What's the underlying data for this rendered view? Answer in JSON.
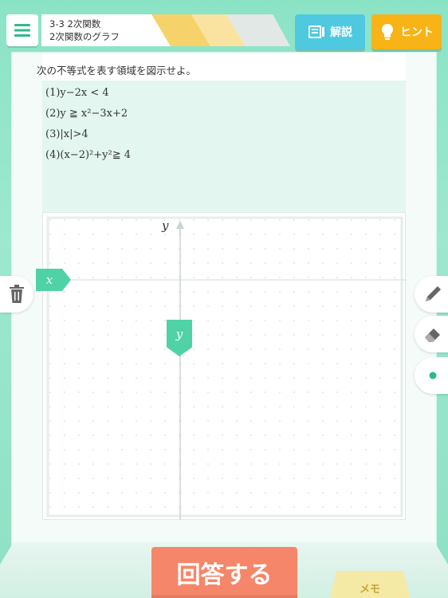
{
  "header": {
    "menu_icon": "hamburger-icon",
    "section": "3-3 2次関数",
    "subtitle": "2次関数のグラフ",
    "explain_label": "解説",
    "hint_label": "ヒント",
    "explain_color": "#4fc9e0",
    "hint_color": "#f8b317"
  },
  "question": {
    "prompt": "次の不等式を表す領域を図示せよ。",
    "problems": [
      "(1)y−2x < 4",
      "(2)y ≧ x²−3x+2",
      "(3)|x|>4",
      "(4)(x−2)²+y²≧ 4"
    ]
  },
  "graph": {
    "x_axis_tag": "x",
    "y_axis_tag": "y",
    "y_axis_label": "y"
  },
  "tools": {
    "trash_icon": "trash-icon",
    "pen_icon": "pencil-icon",
    "eraser_icon": "eraser-icon",
    "point_icon": "dot-icon"
  },
  "footer": {
    "answer_label": "回答する",
    "memo_label": "メモ",
    "answer_color": "#f6866a"
  }
}
